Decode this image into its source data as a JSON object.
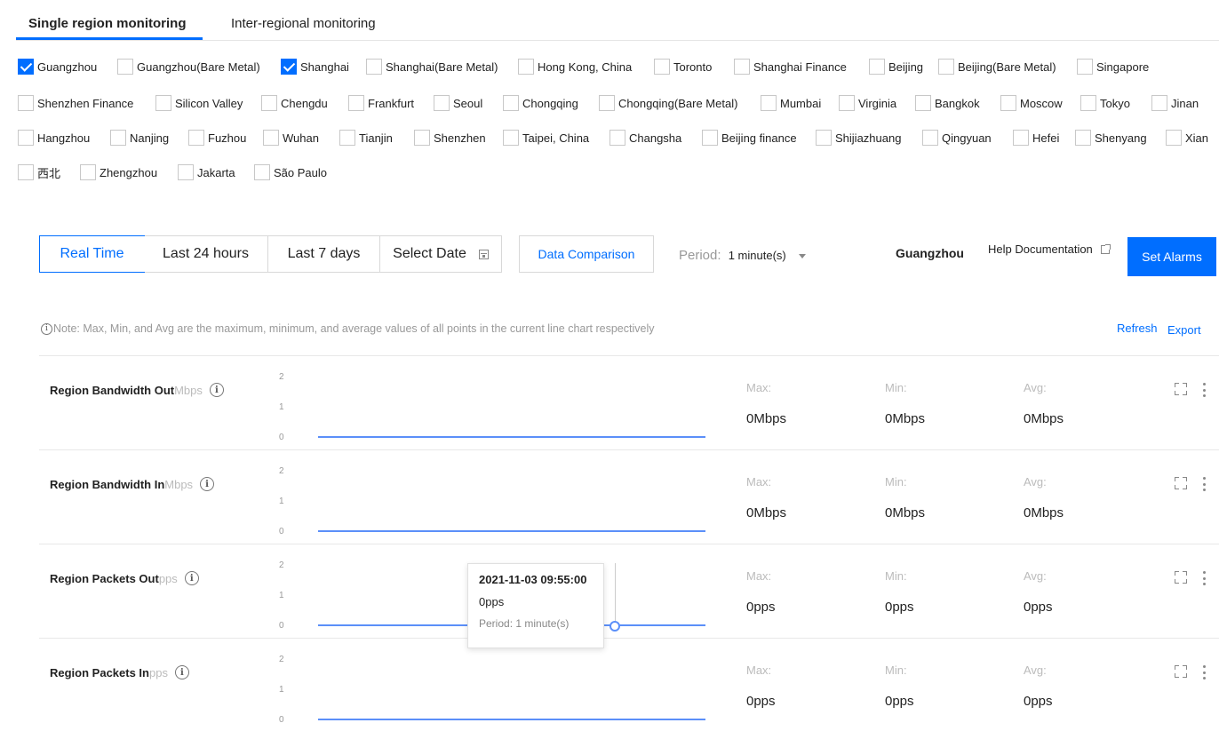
{
  "tabs": [
    {
      "label": "Single region monitoring",
      "active": true
    },
    {
      "label": "Inter-regional monitoring",
      "active": false
    }
  ],
  "regions": [
    [
      {
        "label": "Guangzhou",
        "checked": true
      },
      {
        "label": "Guangzhou(Bare Metal)",
        "checked": false
      },
      {
        "label": "Shanghai",
        "checked": true
      },
      {
        "label": "Shanghai(Bare Metal)",
        "checked": false
      },
      {
        "label": "Hong Kong, China",
        "checked": false
      },
      {
        "label": "Toronto",
        "checked": false
      },
      {
        "label": "Shanghai Finance",
        "checked": false
      },
      {
        "label": "Beijing",
        "checked": false
      },
      {
        "label": "Beijing(Bare Metal)",
        "checked": false
      },
      {
        "label": "Singapore",
        "checked": false
      }
    ],
    [
      {
        "label": "Shenzhen Finance",
        "checked": false
      },
      {
        "label": "Silicon Valley",
        "checked": false
      },
      {
        "label": "Chengdu",
        "checked": false
      },
      {
        "label": "Frankfurt",
        "checked": false
      },
      {
        "label": "Seoul",
        "checked": false
      },
      {
        "label": "Chongqing",
        "checked": false
      },
      {
        "label": "Chongqing(Bare Metal)",
        "checked": false
      },
      {
        "label": "Mumbai",
        "checked": false
      },
      {
        "label": "Virginia",
        "checked": false
      },
      {
        "label": "Bangkok",
        "checked": false
      },
      {
        "label": "Moscow",
        "checked": false
      },
      {
        "label": "Tokyo",
        "checked": false
      },
      {
        "label": "Jinan",
        "checked": false
      }
    ],
    [
      {
        "label": "Hangzhou",
        "checked": false
      },
      {
        "label": "Nanjing",
        "checked": false
      },
      {
        "label": "Fuzhou",
        "checked": false
      },
      {
        "label": "Wuhan",
        "checked": false
      },
      {
        "label": "Tianjin",
        "checked": false
      },
      {
        "label": "Shenzhen",
        "checked": false
      },
      {
        "label": "Taipei, China",
        "checked": false
      },
      {
        "label": "Changsha",
        "checked": false
      },
      {
        "label": "Beijing finance",
        "checked": false
      },
      {
        "label": "Shijiazhuang",
        "checked": false
      },
      {
        "label": "Qingyuan",
        "checked": false
      },
      {
        "label": "Hefei",
        "checked": false
      },
      {
        "label": "Shenyang",
        "checked": false
      },
      {
        "label": "Xian",
        "checked": false
      }
    ],
    [
      {
        "label": "西北",
        "checked": false
      },
      {
        "label": "Zhengzhou",
        "checked": false
      },
      {
        "label": "Jakarta",
        "checked": false
      },
      {
        "label": "São Paulo",
        "checked": false
      }
    ]
  ],
  "toolbar": {
    "time_ranges": [
      "Real Time",
      "Last 24 hours",
      "Last 7 days",
      "Select Date"
    ],
    "active_range": "Real Time",
    "compare_label": "Data Comparison",
    "period_label": "Period:",
    "period_value": "1 minute(s)",
    "current_region": "Guangzhou",
    "help_label": "Help Documentation",
    "alarm_label": "Set Alarms"
  },
  "note": {
    "text": "Note: Max, Min, and Avg are the maximum, minimum, and average values of all points in the current line chart respectively",
    "refresh_label": "Refresh",
    "export_label": "Export"
  },
  "stat_labels": {
    "max": "Max:",
    "min": "Min:",
    "avg": "Avg:"
  },
  "y_ticks": [
    "2",
    "1",
    "0"
  ],
  "metrics": [
    {
      "title": "Region Bandwidth Out",
      "unit": "Mbps",
      "max": "0Mbps",
      "min": "0Mbps",
      "avg": "0Mbps"
    },
    {
      "title": "Region Bandwidth In",
      "unit": "Mbps",
      "max": "0Mbps",
      "min": "0Mbps",
      "avg": "0Mbps"
    },
    {
      "title": "Region Packets Out",
      "unit": "pps",
      "max": "0pps",
      "min": "0pps",
      "avg": "0pps"
    },
    {
      "title": "Region Packets In",
      "unit": "pps",
      "max": "0pps",
      "min": "0pps",
      "avg": "0pps"
    }
  ],
  "tooltip": {
    "time": "2021-11-03 09:55:00",
    "value": "0pps",
    "period": "Period: 1 minute(s)"
  },
  "colors": {
    "accent": "#006eff",
    "series": "#5b8ff9"
  },
  "icons": [
    "check-icon",
    "calendar-icon",
    "caret-down-icon",
    "external-link-icon",
    "info-icon",
    "expand-icon",
    "more-icon"
  ]
}
